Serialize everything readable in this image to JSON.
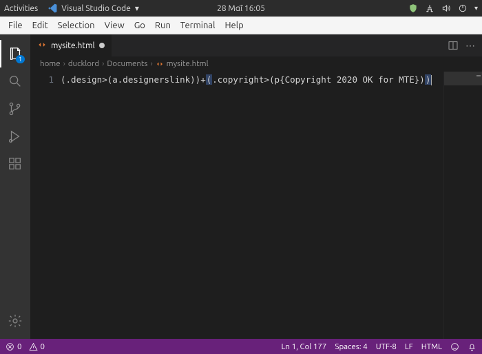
{
  "gnome": {
    "activities": "Activities",
    "app_name": "Visual Studio Code",
    "datetime": "28 Μαΐ 16:05"
  },
  "menubar": [
    "File",
    "Edit",
    "Selection",
    "View",
    "Go",
    "Run",
    "Terminal",
    "Help"
  ],
  "activity": {
    "explorer_badge": "1"
  },
  "tab": {
    "filename": "mysite.html"
  },
  "breadcrumb": {
    "p0": "home",
    "p1": "ducklord",
    "p2": "Documents",
    "p3": "mysite.html",
    "sep": "›"
  },
  "editor": {
    "line_number": "1",
    "seg1": "(.design>(a.designerslink))+",
    "seg2a": "(",
    "seg2b": ".copyright>(p{Copyright 2020 OK for MTE})",
    "seg2c": ")"
  },
  "status": {
    "errors": "0",
    "warnings": "0",
    "position": "Ln 1, Col 177",
    "spaces": "Spaces: 4",
    "encoding": "UTF-8",
    "eol": "LF",
    "lang": "HTML"
  }
}
